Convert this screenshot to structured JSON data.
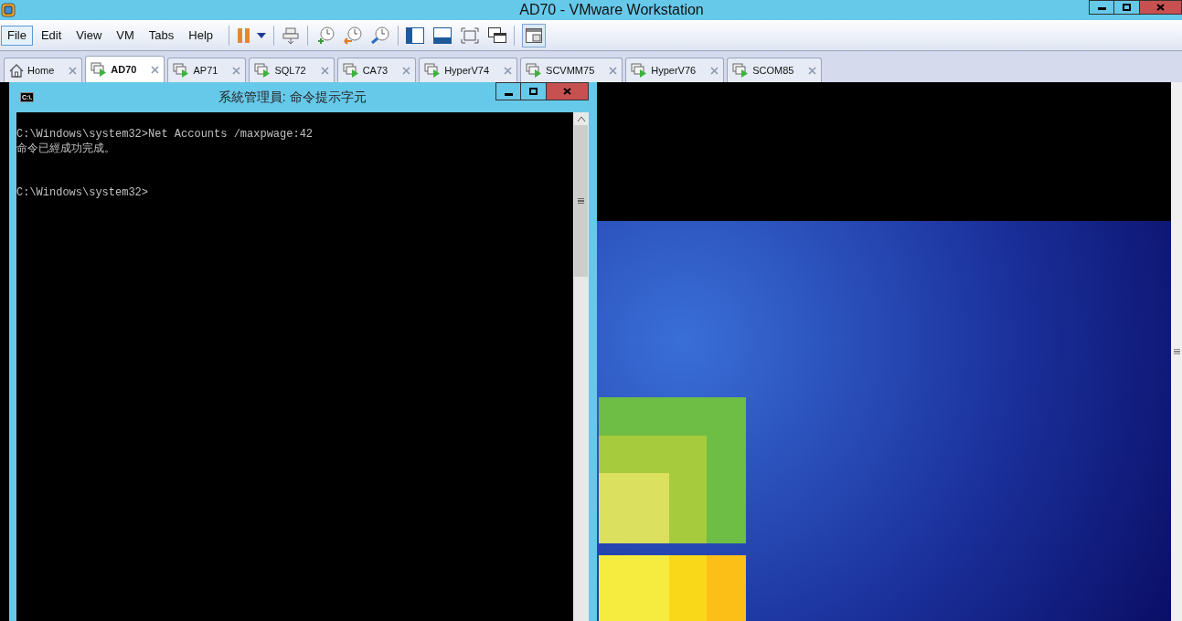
{
  "window": {
    "title": "AD70 - VMware Workstation"
  },
  "menu": [
    {
      "label": "File",
      "selected": true
    },
    {
      "label": "Edit",
      "selected": false
    },
    {
      "label": "View",
      "selected": false
    },
    {
      "label": "VM",
      "selected": false
    },
    {
      "label": "Tabs",
      "selected": false
    },
    {
      "label": "Help",
      "selected": false
    }
  ],
  "tabs": [
    {
      "label": "Home",
      "kind": "home",
      "selected": false
    },
    {
      "label": "AD70",
      "kind": "vm",
      "selected": true
    },
    {
      "label": "AP71",
      "kind": "vm",
      "selected": false
    },
    {
      "label": "SQL72",
      "kind": "vm",
      "selected": false
    },
    {
      "label": "CA73",
      "kind": "vm",
      "selected": false
    },
    {
      "label": "HyperV74",
      "kind": "vm",
      "selected": false
    },
    {
      "label": "SCVMM75",
      "kind": "vm",
      "selected": false
    },
    {
      "label": "HyperV76",
      "kind": "vm",
      "selected": false
    },
    {
      "label": "SCOM85",
      "kind": "vm",
      "selected": false
    }
  ],
  "console": {
    "title": "系統管理員: 命令提示字元",
    "icon_text": "C:\\.",
    "lines": [
      {
        "kind": "command",
        "text": "C:\\Windows\\system32>Net Accounts /maxpwage:42"
      },
      {
        "kind": "output",
        "text": "命令已經成功完成。"
      },
      {
        "kind": "prompt",
        "text": "C:\\Windows\\system32>"
      }
    ]
  }
}
